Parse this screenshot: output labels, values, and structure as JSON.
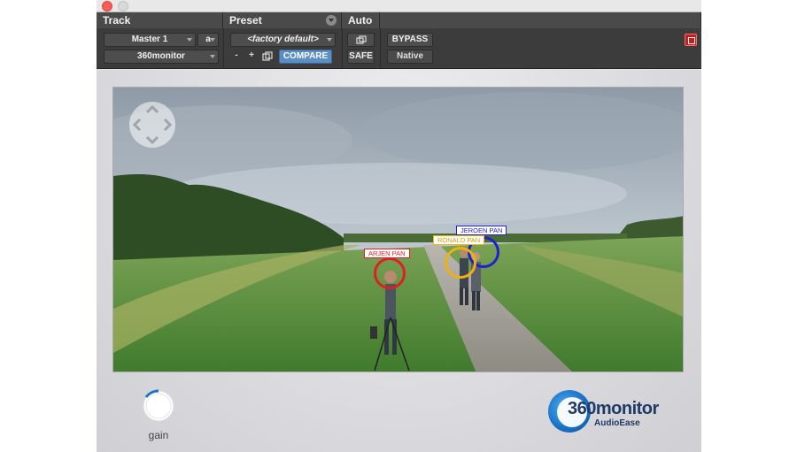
{
  "window": {
    "title": ""
  },
  "header": {
    "track_label": "Track",
    "preset_label": "Preset",
    "auto_label": "Auto"
  },
  "track": {
    "master": "Master 1",
    "channel": "a",
    "plugin": "360monitor"
  },
  "preset": {
    "current": "<factory default>",
    "minus": "-",
    "plus": "+",
    "compare": "COMPARE"
  },
  "auto": {
    "safe": "SAFE"
  },
  "bypass": "BYPASS",
  "native": "Native",
  "video": {
    "pans": [
      {
        "label": "ARJEN PAN",
        "color": "#e02020"
      },
      {
        "label": "RONALD PAN",
        "color": "#f0b010"
      },
      {
        "label": "JEROEN PAN",
        "color": "#2020d0"
      }
    ]
  },
  "gain": {
    "label": "gain"
  },
  "logo": {
    "title": "360monitor",
    "subtitle": "AudioEase"
  },
  "icons": {
    "close": "close-dot-icon",
    "minimize": "minimize-dot-icon",
    "preset_menu": "chevron-down-icon",
    "copy": "copy-settings-icon",
    "nav": "pan-arrows-icon",
    "target": "target-icon"
  }
}
